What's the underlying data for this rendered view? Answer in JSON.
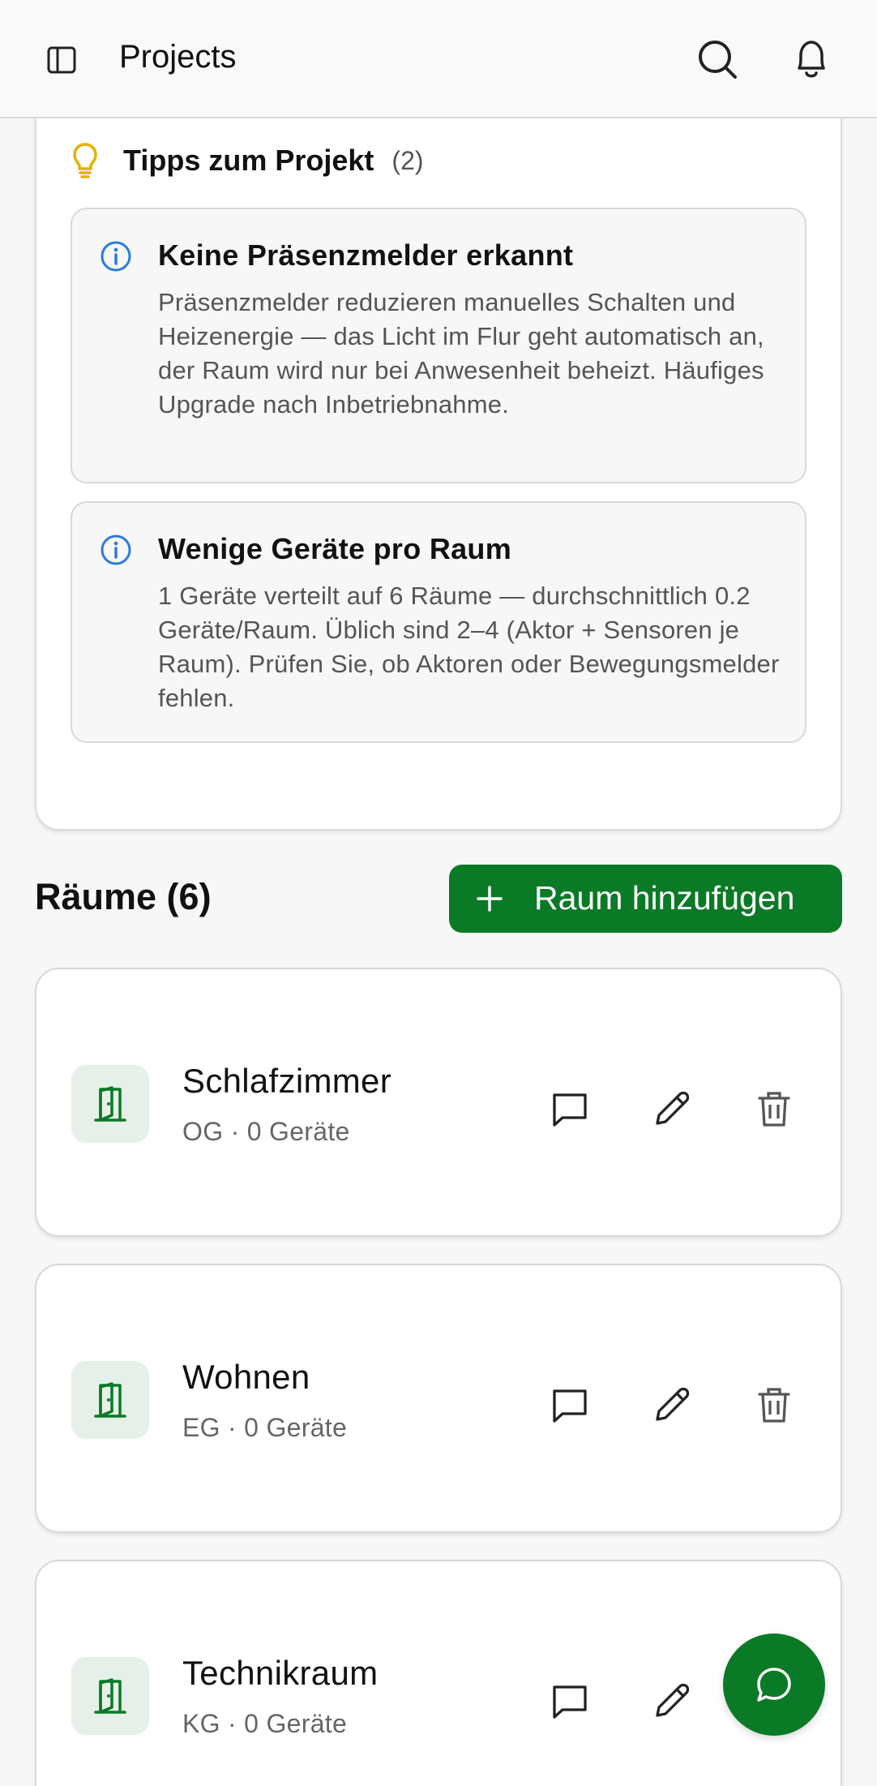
{
  "header": {
    "title": "Projects"
  },
  "tips": {
    "label": "Tipps zum Projekt",
    "count": "(2)",
    "items": [
      {
        "title": "Keine Präsenzmelder erkannt",
        "text": "Präsenzmelder reduzieren manuelles Schalten und Heizenergie — das Licht im Flur geht automatisch an, der Raum wird nur bei Anwesenheit beheizt. Häufiges Upgrade nach Inbetriebnahme."
      },
      {
        "title": "Wenige Geräte pro Raum",
        "text": "1 Geräte verteilt auf 6 Räume — durchschnittlich 0.2 Geräte/Raum. Üblich sind 2–4 (Aktor + Sensoren je Raum). Prüfen Sie, ob Aktoren oder Bewegungsmelder fehlen."
      }
    ]
  },
  "rooms": {
    "title": "Räume (6)",
    "add_label": "Raum hinzufügen",
    "items": [
      {
        "name": "Schlafzimmer",
        "meta": "OG · 0 Geräte"
      },
      {
        "name": "Wohnen",
        "meta": "EG · 0 Geräte"
      },
      {
        "name": "Technikraum",
        "meta": "KG · 0 Geräte"
      }
    ]
  },
  "colors": {
    "accent": "#0a7a26",
    "info": "#2a7ae2",
    "bulb": "#e6b000",
    "tile": "#e6f0e8"
  }
}
